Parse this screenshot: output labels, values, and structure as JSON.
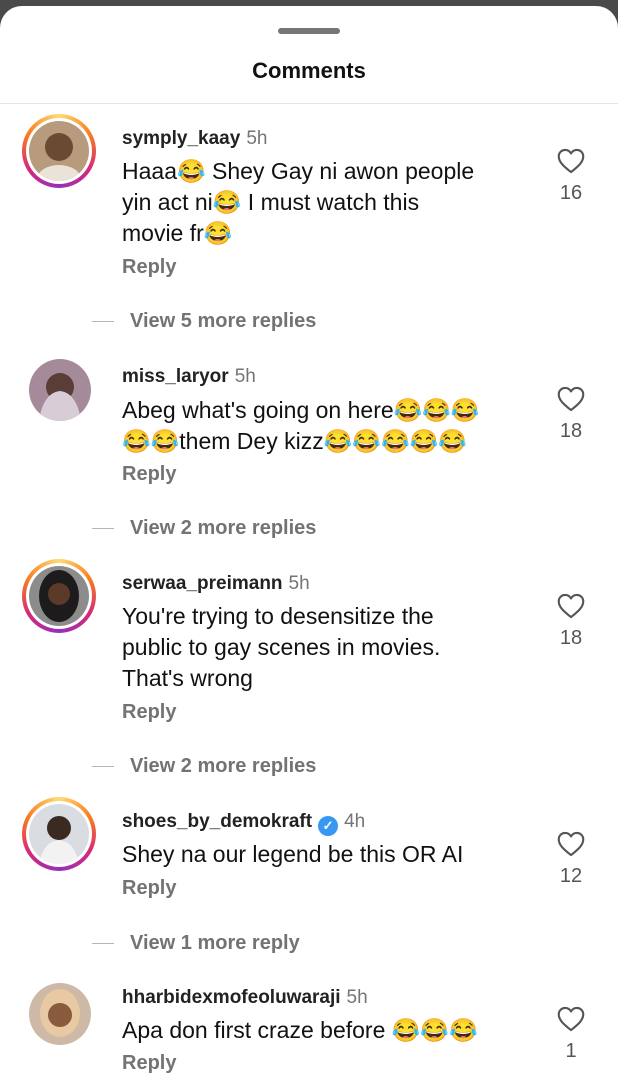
{
  "header": {
    "title": "Comments"
  },
  "comments": [
    {
      "username": "symply_kaay",
      "time": "5h",
      "verified": false,
      "text": "Haaa😂 Shey Gay ni awon people\nyin act ni😂 I must watch this\nmovie fr😂",
      "likes": "16",
      "reply_label": "Reply",
      "view_more": "View 5 more replies"
    },
    {
      "username": "miss_laryor",
      "time": "5h",
      "verified": false,
      "text": "Abeg what's going on here😂😂😂\n😂😂them Dey kizz😂😂😂😂😂",
      "likes": "18",
      "reply_label": "Reply",
      "view_more": "View 2 more replies"
    },
    {
      "username": "serwaa_preimann",
      "time": "5h",
      "verified": false,
      "text": "You're trying to desensitize the\npublic to gay scenes in movies.\nThat's wrong",
      "likes": "18",
      "reply_label": "Reply",
      "view_more": "View 2 more replies"
    },
    {
      "username": "shoes_by_demokraft",
      "time": "4h",
      "verified": true,
      "text": "Shey na our legend be this OR AI",
      "likes": "12",
      "reply_label": "Reply",
      "view_more": "View 1 more reply"
    },
    {
      "username": "hharbidexmofeoluwaraji",
      "time": "5h",
      "verified": false,
      "text": "Apa don first craze before 😂😂😂",
      "likes": "1",
      "reply_label": "Reply",
      "view_more": ""
    }
  ],
  "colors": {
    "background": "#ffffff",
    "secondary_text": "#737373",
    "verified_badge": "#3897f0",
    "story_ring": "#d62976"
  },
  "icons": {
    "like": "heart-outline-icon",
    "verified": "verified-badge-icon"
  }
}
